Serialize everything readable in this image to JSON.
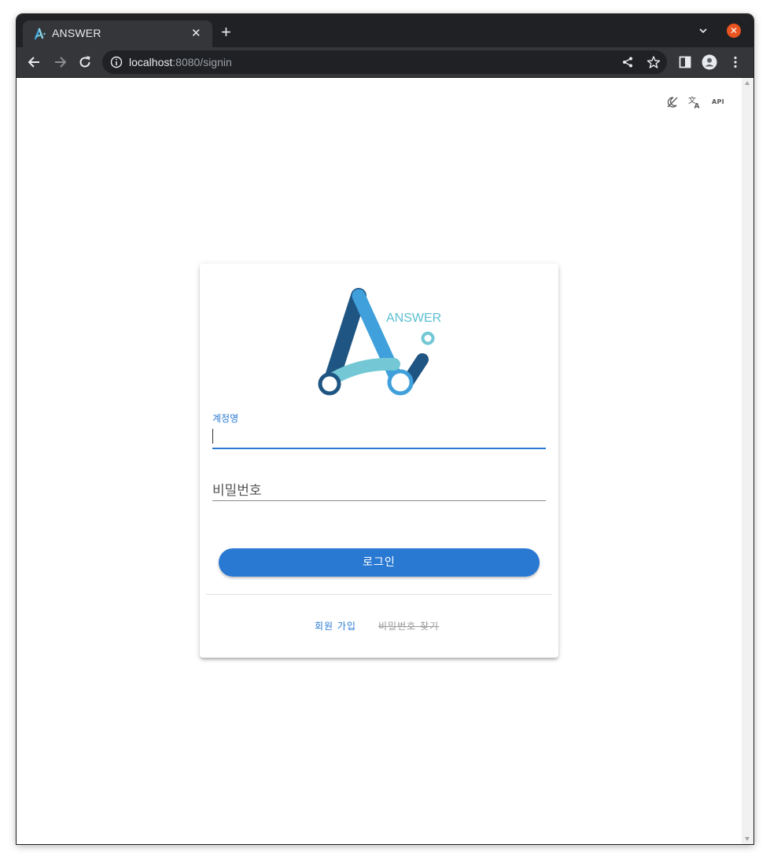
{
  "browser": {
    "tab_title": "ANSWER",
    "tab_close": "✕",
    "new_tab": "+",
    "url_host": "localhost",
    "url_rest": ":8080/signin",
    "window_close": "✕"
  },
  "page_toolbar": {
    "api_label": "API"
  },
  "login": {
    "logo_text": "ANSWER",
    "username_label": "계정명",
    "password_placeholder": "비밀번호",
    "login_button": "로그인",
    "signup_link": "회원 가입",
    "forgot_link": "비밀번호 찾기"
  },
  "colors": {
    "accent": "#2979d3",
    "logo_dark": "#1f5582",
    "logo_mid": "#3fa0db",
    "logo_light": "#74c8d6"
  },
  "icons": [
    "back-arrow-icon",
    "forward-arrow-icon",
    "reload-icon",
    "info-icon",
    "share-icon",
    "star-icon",
    "side-panel-icon",
    "profile-icon",
    "menu-icon",
    "dark-mode-icon",
    "translate-icon",
    "api-icon"
  ]
}
